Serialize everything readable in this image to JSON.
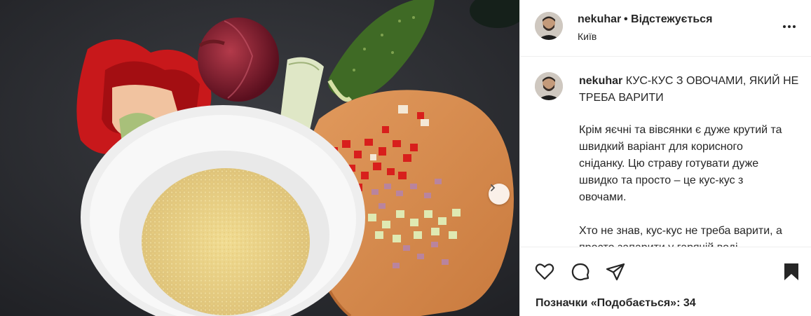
{
  "post": {
    "username": "nekuhar",
    "follow_status": "• Відстежується",
    "location": "Київ",
    "caption_title": "КУС-КУС З ОВОЧАМИ, ЯКИЙ НЕ ТРЕБА ВАРИТИ",
    "caption_paragraph_1": "Крім яєчні та вівсянки є дуже крутий та швидкий варіант для корисного сніданку. Цю страву готувати дуже швидко та просто – це кус-кус з овочами.",
    "caption_paragraph_2": "Хто не знав, кус-кус не треба варити, а просто запарити у гарячій воді.",
    "likes_text": "Позначки «Подобається»: 34"
  },
  "icons": {
    "more": "more-options-icon",
    "like": "heart-icon",
    "comment": "comment-icon",
    "share": "share-icon",
    "save": "bookmark-icon",
    "next": "chevron-right-icon"
  },
  "colors": {
    "text": "#262626",
    "divider": "#efefef",
    "board": "#d98a4e",
    "background_table": "#2b2d31"
  }
}
